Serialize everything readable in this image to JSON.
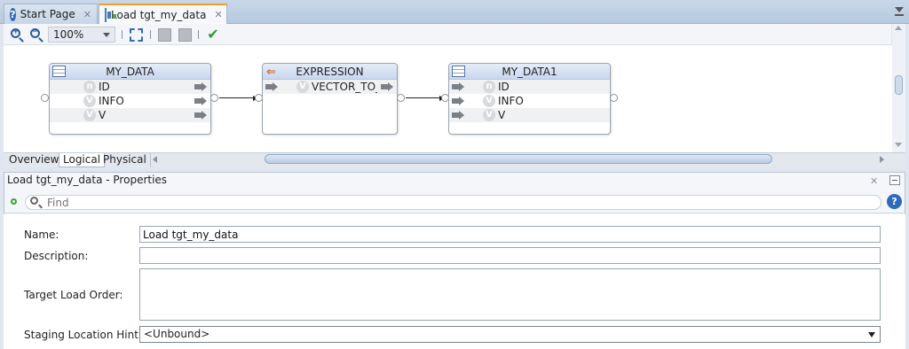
{
  "tabs": [
    {
      "label": "Start Page",
      "icon": "help-icon"
    },
    {
      "label": "Load tgt_my_data",
      "icon": "mapping-icon",
      "active": true
    }
  ],
  "toolbar": {
    "zoom_in_icon": "zoom-in-icon",
    "zoom_out_icon": "zoom-out-icon",
    "zoom_level": "100%",
    "fit_icon": "fit-to-window-icon",
    "validate_icon": "validate-check-icon"
  },
  "diagram": {
    "nodes": [
      {
        "title": "MY_DATA",
        "icon": "table-icon",
        "attributes": [
          {
            "badge": "n",
            "name": "ID"
          },
          {
            "badge": "V",
            "name": "INFO"
          },
          {
            "badge": "V",
            "name": "V"
          }
        ]
      },
      {
        "title": "EXPRESSION",
        "icon": "expression-icon",
        "attributes": [
          {
            "badge": "V",
            "name": "VECTOR_TO_("
          }
        ]
      },
      {
        "title": "MY_DATA1",
        "icon": "table-icon",
        "attributes": [
          {
            "badge": "n",
            "name": "ID"
          },
          {
            "badge": "V",
            "name": "INFO"
          },
          {
            "badge": "V",
            "name": "V"
          }
        ]
      }
    ]
  },
  "diagram_tabs": [
    "Overview",
    "Logical",
    "Physical"
  ],
  "diagram_active_tab": "Logical",
  "properties": {
    "title": "Load tgt_my_data - Properties",
    "find_placeholder": "Find",
    "labels": {
      "name": "Name:",
      "description": "Description:",
      "target_load_order": "Target Load Order:",
      "staging_location_hint": "Staging Location Hint:"
    },
    "values": {
      "name": "Load tgt_my_data",
      "description": "",
      "target_load_order": "",
      "staging_location_hint": "<Unbound>"
    }
  },
  "colors": {
    "accent_tab": "#f0a12a",
    "header_blue": "#c9d7ee",
    "validate_green": "#2e9b2e"
  }
}
